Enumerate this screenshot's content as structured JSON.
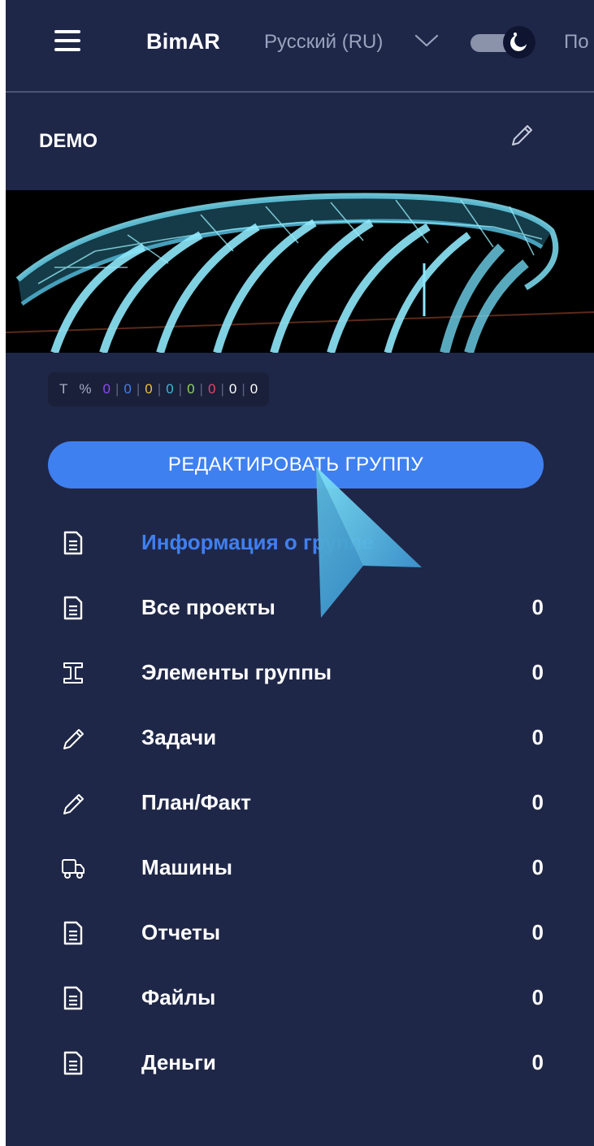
{
  "topbar": {
    "brand": "BimAR",
    "language": "Русский (RU)",
    "cut_text": "По"
  },
  "group": {
    "name": "DEMO"
  },
  "stats": {
    "type_label": "Т",
    "percent_label": "%",
    "values": [
      {
        "value": "0",
        "color": "#8a4bf0"
      },
      {
        "value": "0",
        "color": "#3f80f0"
      },
      {
        "value": "0",
        "color": "#e8c33a"
      },
      {
        "value": "0",
        "color": "#3fb6d8"
      },
      {
        "value": "0",
        "color": "#8fd35a"
      },
      {
        "value": "0",
        "color": "#e0456a"
      },
      {
        "value": "0",
        "color": "#ffffff"
      },
      {
        "value": "0",
        "color": "#ffffff"
      }
    ]
  },
  "edit_button": "РЕДАКТИРОВАТЬ ГРУППУ",
  "nav": {
    "items": [
      {
        "label": "Информация о группе",
        "count": "",
        "icon": "document-icon"
      },
      {
        "label": "Все проекты",
        "count": "0",
        "icon": "document-icon"
      },
      {
        "label": "Элементы группы",
        "count": "0",
        "icon": "i-beam-icon"
      },
      {
        "label": "Задачи",
        "count": "0",
        "icon": "pencil-icon"
      },
      {
        "label": "План/Факт",
        "count": "0",
        "icon": "pencil-icon"
      },
      {
        "label": "Машины",
        "count": "0",
        "icon": "truck-icon"
      },
      {
        "label": "Отчеты",
        "count": "0",
        "icon": "document-icon"
      },
      {
        "label": "Файлы",
        "count": "0",
        "icon": "document-icon"
      },
      {
        "label": "Деньги",
        "count": "0",
        "icon": "document-icon"
      }
    ]
  },
  "colors": {
    "background": "#1f2748",
    "accent": "#3f80f0"
  }
}
